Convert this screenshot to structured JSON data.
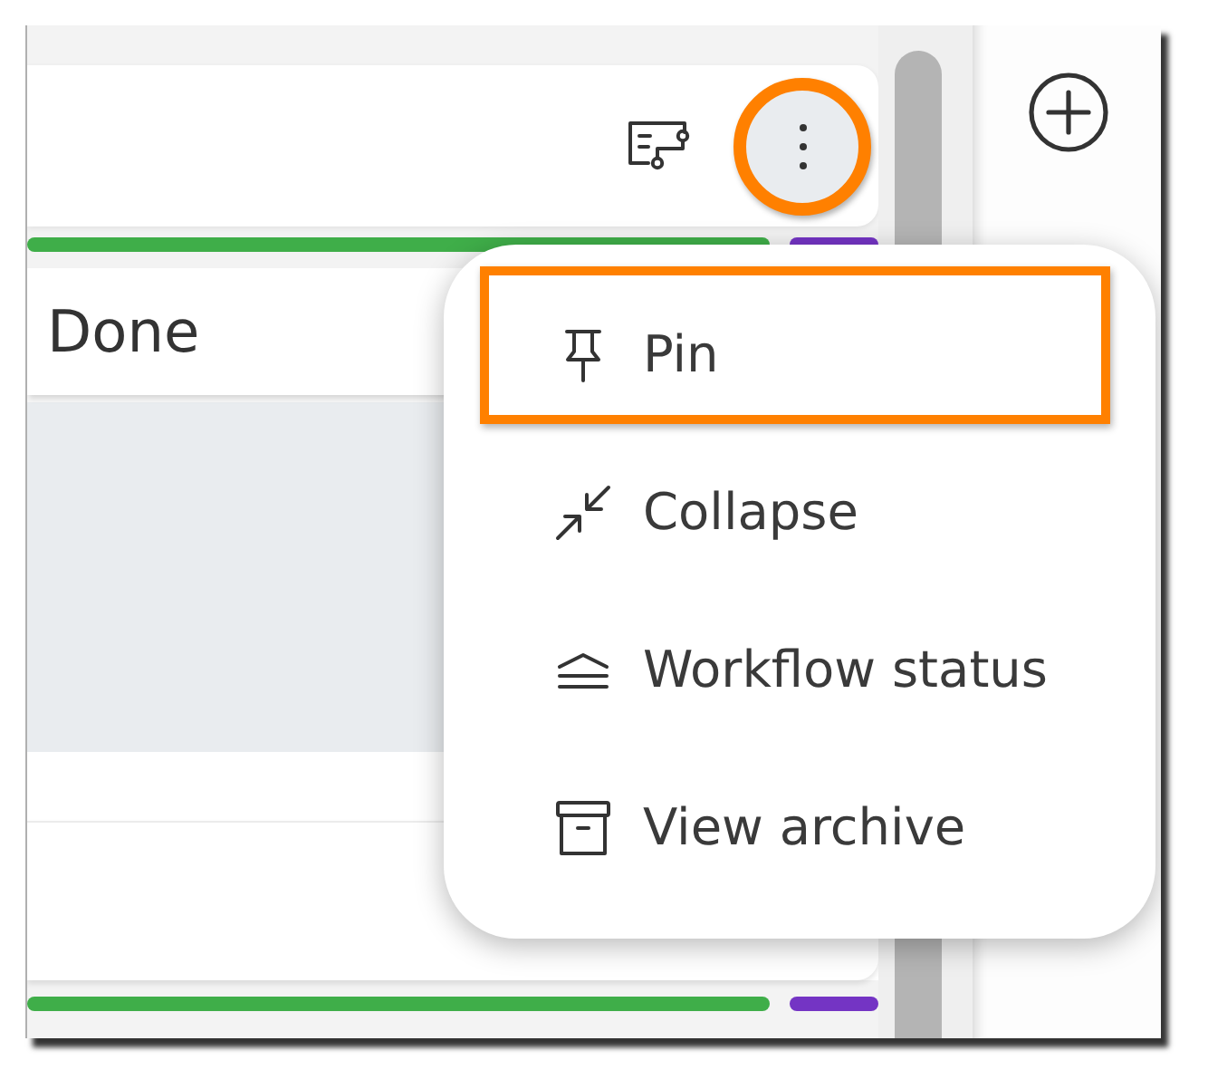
{
  "board": {
    "header_card": {
      "actions": [
        {
          "kind": "workflow",
          "highlighted": false
        },
        {
          "kind": "more",
          "highlighted": true
        }
      ]
    },
    "top_color_bar": [
      {
        "color": "#3fae49"
      },
      {
        "color": "#7434c4"
      }
    ],
    "column": {
      "title": "Done"
    },
    "bottom_color_bar": [
      {
        "color": "#3fae49"
      },
      {
        "color": "#7434c4"
      }
    ]
  },
  "side_panel": {
    "buttons": [
      {
        "kind": "add"
      }
    ]
  },
  "context_menu": {
    "items": [
      {
        "kind": "pin",
        "label": "Pin",
        "highlighted": true
      },
      {
        "kind": "collapse",
        "label": "Collapse",
        "highlighted": false
      },
      {
        "kind": "workflow-status",
        "label": "Workflow status",
        "highlighted": false
      },
      {
        "kind": "archive",
        "label": "View archive",
        "highlighted": false
      }
    ]
  }
}
